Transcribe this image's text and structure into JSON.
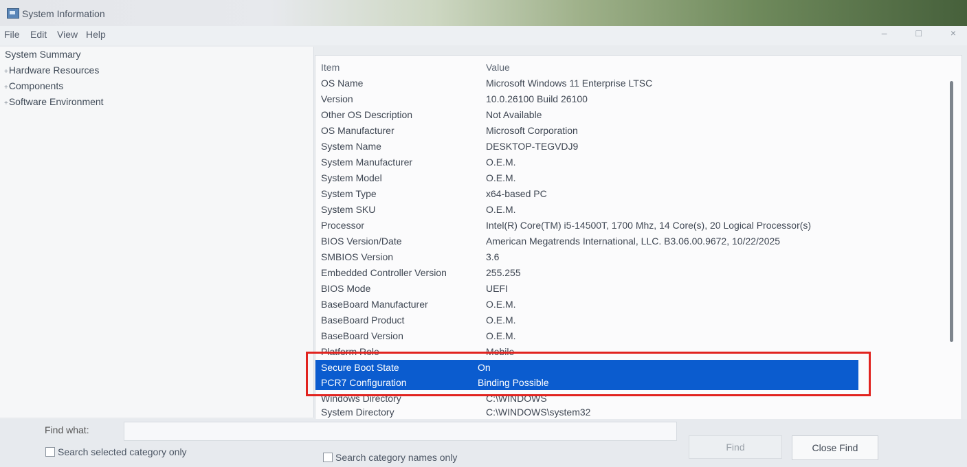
{
  "window": {
    "title": "System Information"
  },
  "menu": [
    "File",
    "Edit",
    "View",
    "Help"
  ],
  "window_controls": [
    "–",
    "□",
    "×"
  ],
  "tree": [
    {
      "label": "System Summary",
      "prefix": ""
    },
    {
      "label": "Hardware Resources",
      "prefix": "+"
    },
    {
      "label": "Components",
      "prefix": "+"
    },
    {
      "label": "Software Environment",
      "prefix": "+"
    }
  ],
  "table": {
    "header": {
      "item": "Item",
      "value": "Value"
    },
    "rows": [
      {
        "item": "OS Name",
        "value": "Microsoft Windows 11 Enterprise LTSC"
      },
      {
        "item": "Version",
        "value": "10.0.26100 Build 26100"
      },
      {
        "item": "Other OS Description",
        "value": "Not Available"
      },
      {
        "item": "OS Manufacturer",
        "value": "Microsoft Corporation"
      },
      {
        "item": "System Name",
        "value": "DESKTOP-TEGVDJ9"
      },
      {
        "item": "System Manufacturer",
        "value": "O.E.M."
      },
      {
        "item": "System Model",
        "value": "O.E.M."
      },
      {
        "item": "System Type",
        "value": "x64-based PC"
      },
      {
        "item": "System SKU",
        "value": "O.E.M."
      },
      {
        "item": "Processor",
        "value": "Intel(R) Core(TM) i5-14500T, 1700 Mhz, 14 Core(s), 20 Logical Processor(s)"
      },
      {
        "item": "BIOS Version/Date",
        "value": "American Megatrends International, LLC. B3.06.00.9672, 10/22/2025"
      },
      {
        "item": "SMBIOS Version",
        "value": "3.6"
      },
      {
        "item": "Embedded Controller Version",
        "value": "255.255"
      },
      {
        "item": "BIOS Mode",
        "value": "UEFI"
      },
      {
        "item": "BaseBoard Manufacturer",
        "value": "O.E.M."
      },
      {
        "item": "BaseBoard Product",
        "value": "O.E.M."
      },
      {
        "item": "BaseBoard Version",
        "value": "O.E.M."
      },
      {
        "item": "Platform Role",
        "value": "Mobile"
      },
      {
        "item": "Secure Boot State",
        "value": "On",
        "selected": true
      },
      {
        "item": "PCR7 Configuration",
        "value": "Binding Possible",
        "selected": true
      },
      {
        "item": "Windows Directory",
        "value": "C:\\WINDOWS"
      },
      {
        "item": "System Directory",
        "value": "C:\\WINDOWS\\system32"
      }
    ]
  },
  "find": {
    "label": "Find what:",
    "value": "",
    "find_button": "Find",
    "close_button": "Close Find",
    "search_selected": "Search selected category only",
    "search_names": "Search category names only"
  },
  "colors": {
    "selection": "#0b5ccf",
    "highlight_box": "#e1231f"
  }
}
